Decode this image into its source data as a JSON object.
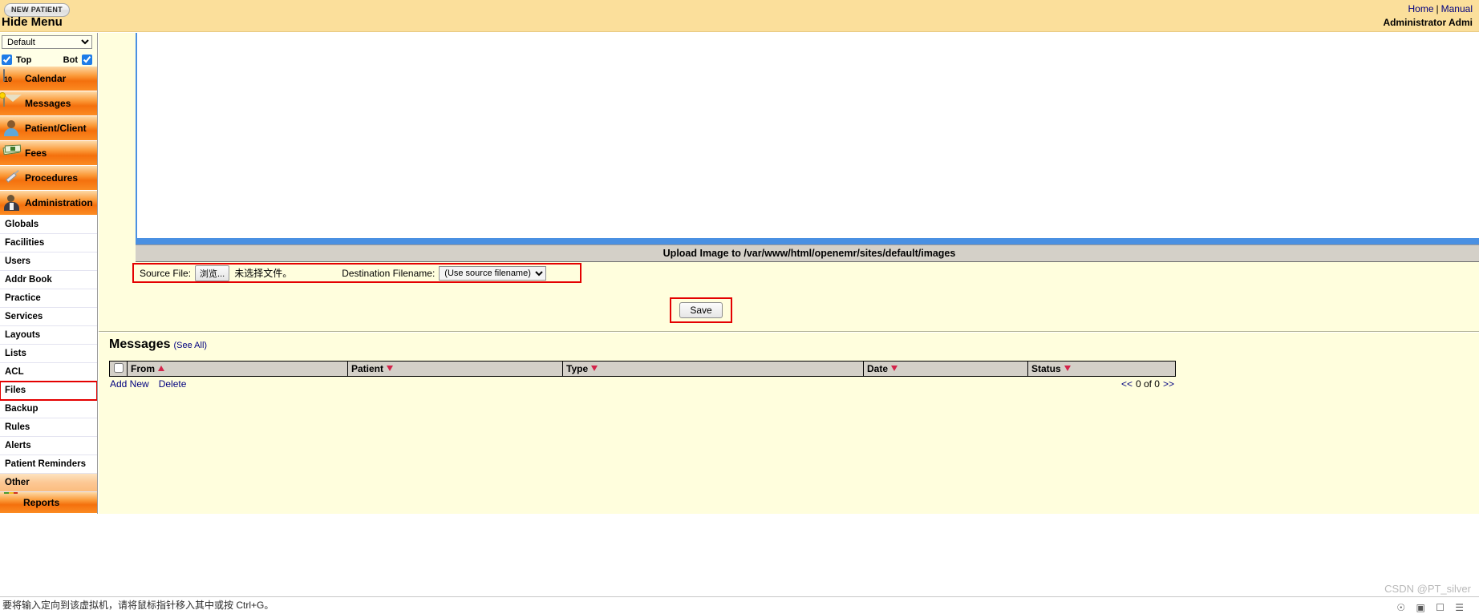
{
  "header": {
    "new_patient_label": "NEW PATIENT",
    "hide_menu_label": "Hide Menu",
    "home_link": "Home",
    "separator": "|",
    "manual_link": "Manual",
    "admin_user": "Administrator Admi"
  },
  "sidebar": {
    "theme_select_value": "Default",
    "top_label": "Top",
    "bot_label": "Bot",
    "main_items": [
      {
        "label": "Calendar",
        "icon": "calendar-icon"
      },
      {
        "label": "Messages",
        "icon": "envelope-icon"
      },
      {
        "label": "Patient/Client",
        "icon": "person-icon"
      },
      {
        "label": "Fees",
        "icon": "money-icon"
      },
      {
        "label": "Procedures",
        "icon": "syringe-icon"
      },
      {
        "label": "Administration",
        "icon": "admin-person-icon"
      }
    ],
    "admin_items": [
      {
        "label": "Globals",
        "highlighted": false,
        "orange": false
      },
      {
        "label": "Facilities",
        "highlighted": false,
        "orange": false
      },
      {
        "label": "Users",
        "highlighted": false,
        "orange": false
      },
      {
        "label": "Addr Book",
        "highlighted": false,
        "orange": false
      },
      {
        "label": "Practice",
        "highlighted": false,
        "orange": false
      },
      {
        "label": "Services",
        "highlighted": false,
        "orange": false
      },
      {
        "label": "Layouts",
        "highlighted": false,
        "orange": false
      },
      {
        "label": "Lists",
        "highlighted": false,
        "orange": false
      },
      {
        "label": "ACL",
        "highlighted": false,
        "orange": false
      },
      {
        "label": "Files",
        "highlighted": true,
        "orange": false
      },
      {
        "label": "Backup",
        "highlighted": false,
        "orange": false
      },
      {
        "label": "Rules",
        "highlighted": false,
        "orange": false
      },
      {
        "label": "Alerts",
        "highlighted": false,
        "orange": false
      },
      {
        "label": "Patient Reminders",
        "highlighted": false,
        "orange": false
      },
      {
        "label": "Other",
        "highlighted": false,
        "orange": true
      }
    ],
    "reports_label": "Reports"
  },
  "upload": {
    "banner": "Upload Image to /var/www/html/openemr/sites/default/images",
    "source_file_label": "Source File:",
    "browse_button": "浏览...",
    "no_file_text": "未选择文件。",
    "destination_label": "Destination Filename:",
    "destination_value": "(Use source filename)",
    "save_button": "Save"
  },
  "messages": {
    "title": "Messages",
    "see_all": "(See All)",
    "columns": [
      "From",
      "Patient",
      "Type",
      "Date",
      "Status"
    ],
    "sort_directions": [
      "up",
      "down",
      "down",
      "down",
      "down"
    ],
    "rows": [],
    "add_new": "Add New",
    "delete": "Delete",
    "pager_prev": "<<",
    "pager_text": "0 of 0",
    "pager_next": ">>"
  },
  "status_bar": {
    "text": "要将输入定向到该虚拟机，请将鼠标指针移入其中或按 Ctrl+G。"
  },
  "watermark": {
    "text": "CSDN @PT_silver"
  },
  "colors": {
    "header_bg": "#fbdf9b",
    "content_bg": "#fffedd",
    "accent_orange": "#f4700d",
    "highlight_red": "#e40000",
    "link_blue": "#00007f",
    "editor_border": "#4a90e2"
  }
}
